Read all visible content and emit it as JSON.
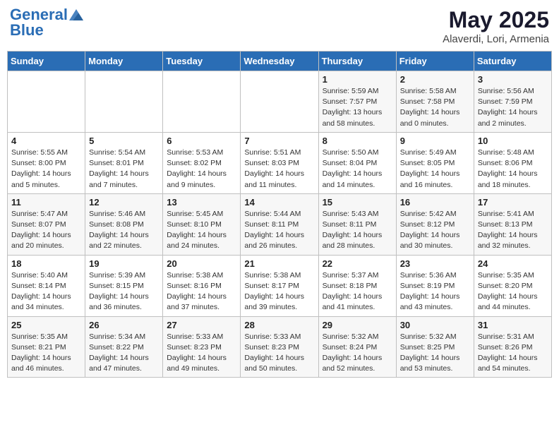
{
  "logo": {
    "line1": "General",
    "line2": "Blue"
  },
  "title": "May 2025",
  "subtitle": "Alaverdi, Lori, Armenia",
  "days_header": [
    "Sunday",
    "Monday",
    "Tuesday",
    "Wednesday",
    "Thursday",
    "Friday",
    "Saturday"
  ],
  "weeks": [
    [
      {
        "num": "",
        "info": ""
      },
      {
        "num": "",
        "info": ""
      },
      {
        "num": "",
        "info": ""
      },
      {
        "num": "",
        "info": ""
      },
      {
        "num": "1",
        "info": "Sunrise: 5:59 AM\nSunset: 7:57 PM\nDaylight: 13 hours\nand 58 minutes."
      },
      {
        "num": "2",
        "info": "Sunrise: 5:58 AM\nSunset: 7:58 PM\nDaylight: 14 hours\nand 0 minutes."
      },
      {
        "num": "3",
        "info": "Sunrise: 5:56 AM\nSunset: 7:59 PM\nDaylight: 14 hours\nand 2 minutes."
      }
    ],
    [
      {
        "num": "4",
        "info": "Sunrise: 5:55 AM\nSunset: 8:00 PM\nDaylight: 14 hours\nand 5 minutes."
      },
      {
        "num": "5",
        "info": "Sunrise: 5:54 AM\nSunset: 8:01 PM\nDaylight: 14 hours\nand 7 minutes."
      },
      {
        "num": "6",
        "info": "Sunrise: 5:53 AM\nSunset: 8:02 PM\nDaylight: 14 hours\nand 9 minutes."
      },
      {
        "num": "7",
        "info": "Sunrise: 5:51 AM\nSunset: 8:03 PM\nDaylight: 14 hours\nand 11 minutes."
      },
      {
        "num": "8",
        "info": "Sunrise: 5:50 AM\nSunset: 8:04 PM\nDaylight: 14 hours\nand 14 minutes."
      },
      {
        "num": "9",
        "info": "Sunrise: 5:49 AM\nSunset: 8:05 PM\nDaylight: 14 hours\nand 16 minutes."
      },
      {
        "num": "10",
        "info": "Sunrise: 5:48 AM\nSunset: 8:06 PM\nDaylight: 14 hours\nand 18 minutes."
      }
    ],
    [
      {
        "num": "11",
        "info": "Sunrise: 5:47 AM\nSunset: 8:07 PM\nDaylight: 14 hours\nand 20 minutes."
      },
      {
        "num": "12",
        "info": "Sunrise: 5:46 AM\nSunset: 8:08 PM\nDaylight: 14 hours\nand 22 minutes."
      },
      {
        "num": "13",
        "info": "Sunrise: 5:45 AM\nSunset: 8:10 PM\nDaylight: 14 hours\nand 24 minutes."
      },
      {
        "num": "14",
        "info": "Sunrise: 5:44 AM\nSunset: 8:11 PM\nDaylight: 14 hours\nand 26 minutes."
      },
      {
        "num": "15",
        "info": "Sunrise: 5:43 AM\nSunset: 8:11 PM\nDaylight: 14 hours\nand 28 minutes."
      },
      {
        "num": "16",
        "info": "Sunrise: 5:42 AM\nSunset: 8:12 PM\nDaylight: 14 hours\nand 30 minutes."
      },
      {
        "num": "17",
        "info": "Sunrise: 5:41 AM\nSunset: 8:13 PM\nDaylight: 14 hours\nand 32 minutes."
      }
    ],
    [
      {
        "num": "18",
        "info": "Sunrise: 5:40 AM\nSunset: 8:14 PM\nDaylight: 14 hours\nand 34 minutes."
      },
      {
        "num": "19",
        "info": "Sunrise: 5:39 AM\nSunset: 8:15 PM\nDaylight: 14 hours\nand 36 minutes."
      },
      {
        "num": "20",
        "info": "Sunrise: 5:38 AM\nSunset: 8:16 PM\nDaylight: 14 hours\nand 37 minutes."
      },
      {
        "num": "21",
        "info": "Sunrise: 5:38 AM\nSunset: 8:17 PM\nDaylight: 14 hours\nand 39 minutes."
      },
      {
        "num": "22",
        "info": "Sunrise: 5:37 AM\nSunset: 8:18 PM\nDaylight: 14 hours\nand 41 minutes."
      },
      {
        "num": "23",
        "info": "Sunrise: 5:36 AM\nSunset: 8:19 PM\nDaylight: 14 hours\nand 43 minutes."
      },
      {
        "num": "24",
        "info": "Sunrise: 5:35 AM\nSunset: 8:20 PM\nDaylight: 14 hours\nand 44 minutes."
      }
    ],
    [
      {
        "num": "25",
        "info": "Sunrise: 5:35 AM\nSunset: 8:21 PM\nDaylight: 14 hours\nand 46 minutes."
      },
      {
        "num": "26",
        "info": "Sunrise: 5:34 AM\nSunset: 8:22 PM\nDaylight: 14 hours\nand 47 minutes."
      },
      {
        "num": "27",
        "info": "Sunrise: 5:33 AM\nSunset: 8:23 PM\nDaylight: 14 hours\nand 49 minutes."
      },
      {
        "num": "28",
        "info": "Sunrise: 5:33 AM\nSunset: 8:23 PM\nDaylight: 14 hours\nand 50 minutes."
      },
      {
        "num": "29",
        "info": "Sunrise: 5:32 AM\nSunset: 8:24 PM\nDaylight: 14 hours\nand 52 minutes."
      },
      {
        "num": "30",
        "info": "Sunrise: 5:32 AM\nSunset: 8:25 PM\nDaylight: 14 hours\nand 53 minutes."
      },
      {
        "num": "31",
        "info": "Sunrise: 5:31 AM\nSunset: 8:26 PM\nDaylight: 14 hours\nand 54 minutes."
      }
    ]
  ]
}
